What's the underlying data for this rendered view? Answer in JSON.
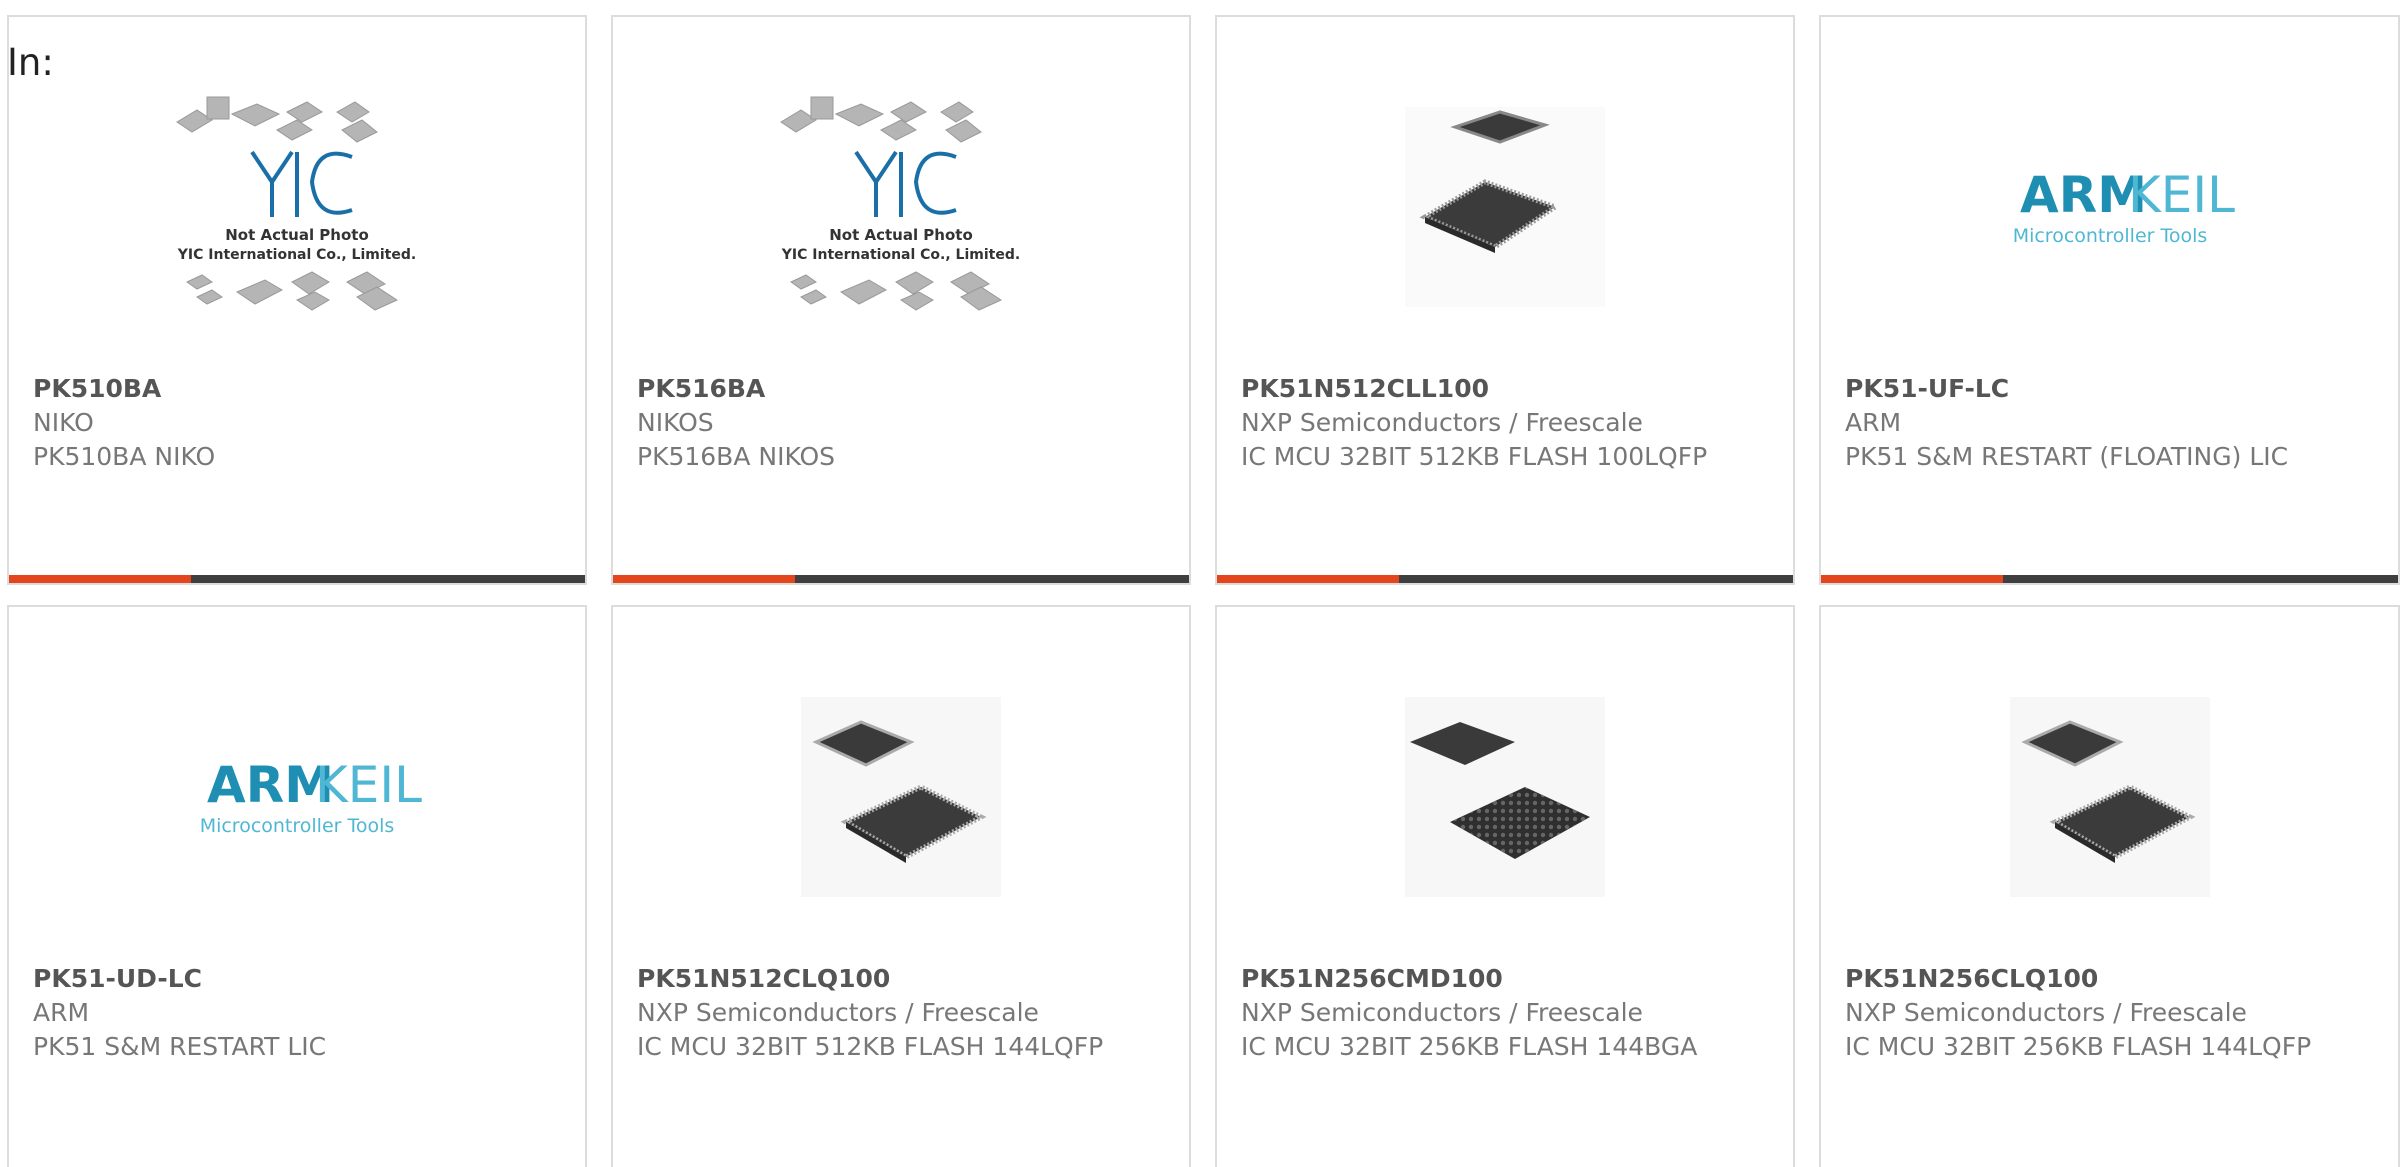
{
  "header": {
    "in_label": "In:"
  },
  "placeholder": {
    "line1": "Not Actual Photo",
    "line2": "YIC International Co., Limited."
  },
  "arm_logo": {
    "arm": "ARM",
    "keil": "KEIL",
    "tagline": "Microcontroller Tools"
  },
  "colors": {
    "accent": "#e2461a",
    "bar": "#3f3f3f",
    "arm_blue": "#1e8fb3",
    "keil_blue": "#4fb7d3"
  },
  "products": [
    {
      "part": "PK510BA",
      "maker": "NIKO",
      "desc": "PK510BA NIKO",
      "image": "placeholder"
    },
    {
      "part": "PK516BA",
      "maker": "NIKOS",
      "desc": "PK516BA NIKOS",
      "image": "placeholder"
    },
    {
      "part": "PK51N512CLL100",
      "maker": "NXP Semiconductors / Freescale",
      "desc": "IC MCU 32BIT 512KB FLASH 100LQFP",
      "image": "chip-lqfp"
    },
    {
      "part": "PK51-UF-LC",
      "maker": "ARM",
      "desc": "PK51 S&M RESTART (FLOATING) LIC",
      "image": "arm-keil-logo"
    },
    {
      "part": "PK51-UD-LC",
      "maker": "ARM",
      "desc": "PK51 S&M RESTART LIC",
      "image": "arm-keil-logo"
    },
    {
      "part": "PK51N512CLQ100",
      "maker": "NXP Semiconductors / Freescale",
      "desc": "IC MCU 32BIT 512KB FLASH 144LQFP",
      "image": "chip-lqfp"
    },
    {
      "part": "PK51N256CMD100",
      "maker": "NXP Semiconductors / Freescale",
      "desc": "IC MCU 32BIT 256KB FLASH 144BGA",
      "image": "chip-bga"
    },
    {
      "part": "PK51N256CLQ100",
      "maker": "NXP Semiconductors / Freescale",
      "desc": "IC MCU 32BIT 256KB FLASH 144LQFP",
      "image": "chip-lqfp"
    }
  ]
}
